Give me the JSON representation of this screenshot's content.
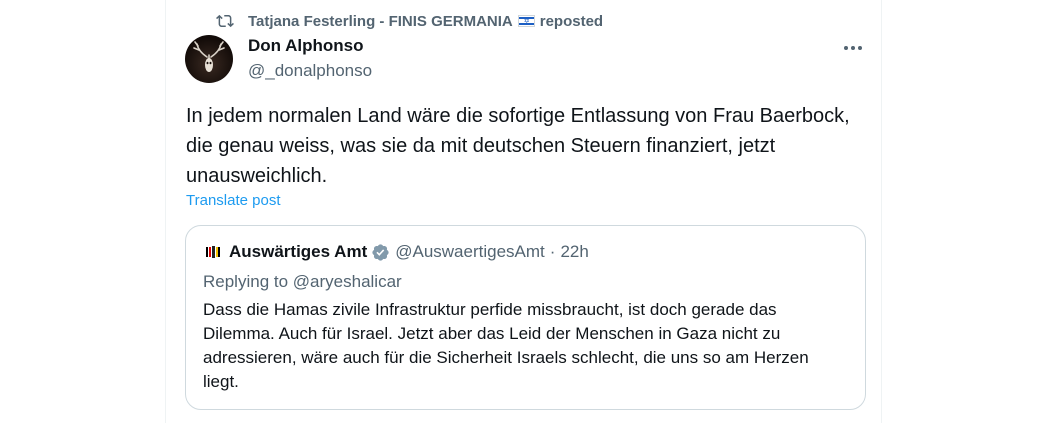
{
  "repost": {
    "reposter_name": "Tatjana Festerling - FINIS GERMANIA",
    "suffix": "reposted"
  },
  "post": {
    "author_name": "Don Alphonso",
    "author_handle": "@_donalphonso",
    "text": "In jedem normalen Land wäre die sofortige Entlassung von Frau Baerbock, die genau weiss, was sie da mit deutschen Steuern finanziert, jetzt unausweichlich.",
    "translate_label": "Translate post"
  },
  "quote": {
    "author_name": "Auswärtiges Amt",
    "author_handle": "@AuswaertigesAmt",
    "separator": "·",
    "time": "22h",
    "reply_prefix": "Replying to",
    "reply_to": "@aryeshalicar",
    "text": "Dass die Hamas zivile Infrastruktur perfide missbraucht, ist doch gerade das Dilemma. Auch für Israel. Jetzt aber das Leid der Menschen in Gaza nicht zu adressieren, wäre auch für die Sicherheit Israels schlecht, die uns so am Herzen liegt."
  },
  "icons": {
    "repost": "repost-icon",
    "flag": "israel-flag-icon",
    "more": "more-options-icon",
    "verified": "verified-badge-icon",
    "quote_avatar": "federal-eagle-icon"
  },
  "colors": {
    "link": "#1d9bf0",
    "secondary_text": "#536471",
    "border": "#cfd9de",
    "verified": "#829aab"
  }
}
